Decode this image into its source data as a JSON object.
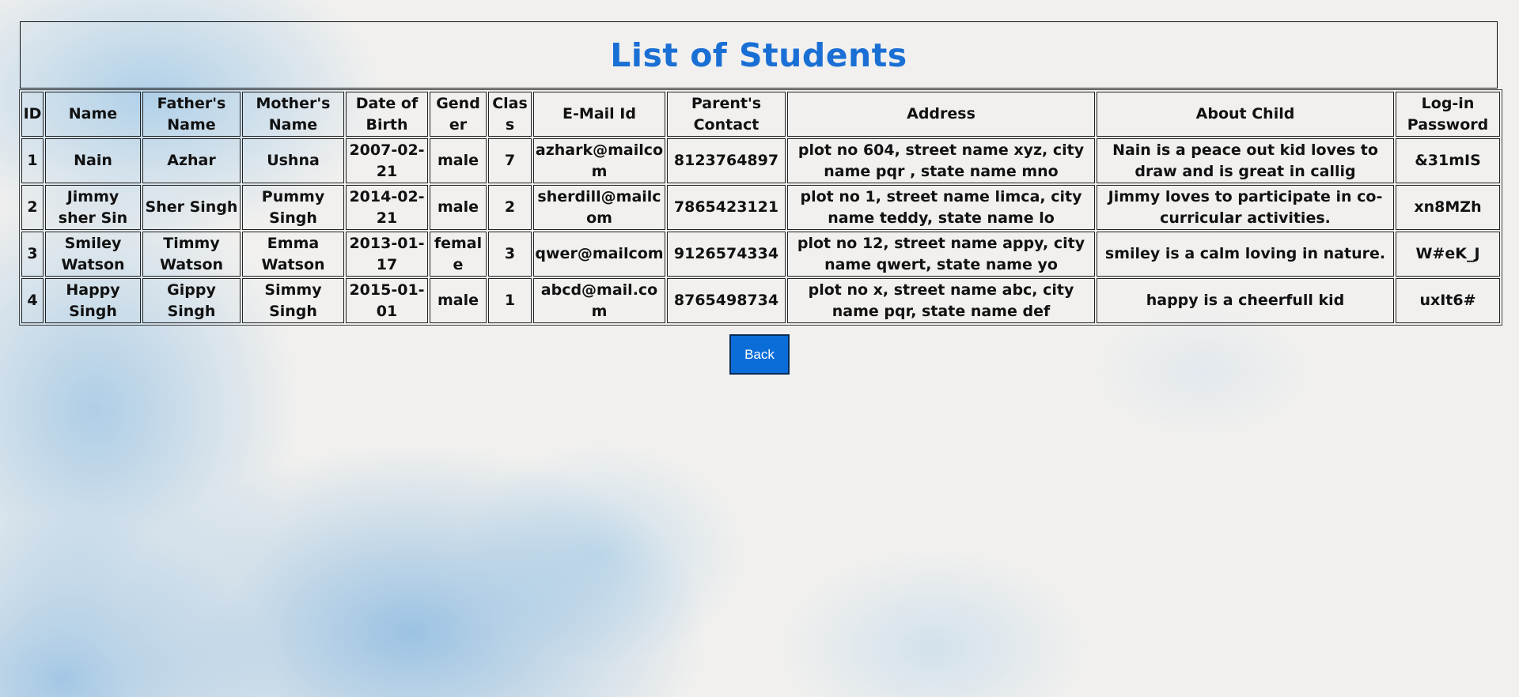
{
  "page": {
    "title": "List of Students"
  },
  "table": {
    "headers": [
      "ID",
      "Name",
      "Father's Name",
      "Mother's Name",
      "Date of Birth",
      "Gender",
      "Class",
      "E-Mail Id",
      "Parent's Contact",
      "Address",
      "About Child",
      "Log-in Password"
    ],
    "rows": [
      [
        "1",
        "Nain",
        "Azhar",
        "Ushna",
        "2007-02-21",
        "male",
        "7",
        "azhark@mailcom",
        "8123764897",
        "plot no 604, street name xyz, city name pqr , state name mno",
        "Nain is a peace out kid loves to draw and is great in callig",
        "&31mIS"
      ],
      [
        "2",
        "Jimmy sher Sin",
        "Sher Singh",
        "Pummy Singh",
        "2014-02-21",
        "male",
        "2",
        "sherdill@mailcom",
        "7865423121",
        "plot no 1, street name limca, city name teddy, state name lo",
        "Jimmy loves to participate in co-curricular activities.",
        "xn8MZh"
      ],
      [
        "3",
        "Smiley Watson",
        "Timmy Watson",
        "Emma Watson",
        "2013-01-17",
        "female",
        "3",
        "qwer@mailcom",
        "9126574334",
        "plot no 12, street name appy, city name qwert, state name yo",
        "smiley is a calm loving in nature.",
        "W#eK_J"
      ],
      [
        "4",
        "Happy Singh",
        "Gippy Singh",
        "Simmy Singh",
        "2015-01-01",
        "male",
        "1",
        "abcd@mail.com",
        "8765498734",
        "plot no x, street name abc, city name pqr, state name def",
        "happy is a cheerfull kid",
        "uxIt6#"
      ]
    ]
  },
  "actions": {
    "back_label": "Back"
  },
  "colors": {
    "title": "#1a6fd4",
    "button_bg": "#0b6dd8",
    "button_text": "#ffffff"
  }
}
